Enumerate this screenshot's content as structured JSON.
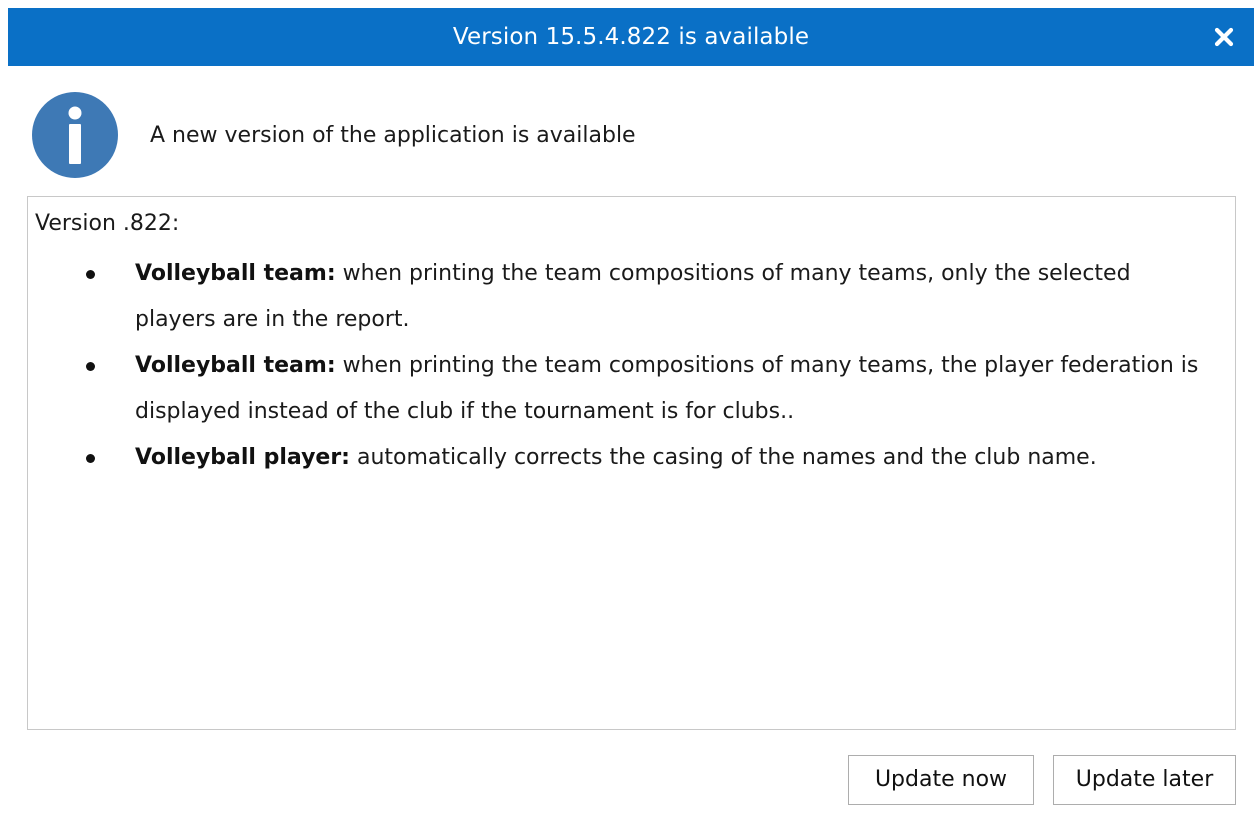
{
  "window": {
    "title": "Version 15.5.4.822 is available",
    "close_icon": "close-icon"
  },
  "header": {
    "icon": "info-icon",
    "message": "A new version of the application is available"
  },
  "notes": {
    "heading": "Version .822:",
    "items": [
      {
        "label": "Volleyball team:",
        "text": " when printing the team compositions of many teams, only the selected players are in the report."
      },
      {
        "label": "Volleyball team:",
        "text": " when printing the team compositions of many teams, the player federation is displayed instead of the club if the tournament is for clubs.."
      },
      {
        "label": "Volleyball player:",
        "text": " automatically corrects the casing of the names and the club name."
      }
    ]
  },
  "buttons": {
    "update_now": "Update now",
    "update_later": "Update later"
  },
  "colors": {
    "titlebar": "#0a70c6",
    "info_icon": "#3e79b5"
  }
}
